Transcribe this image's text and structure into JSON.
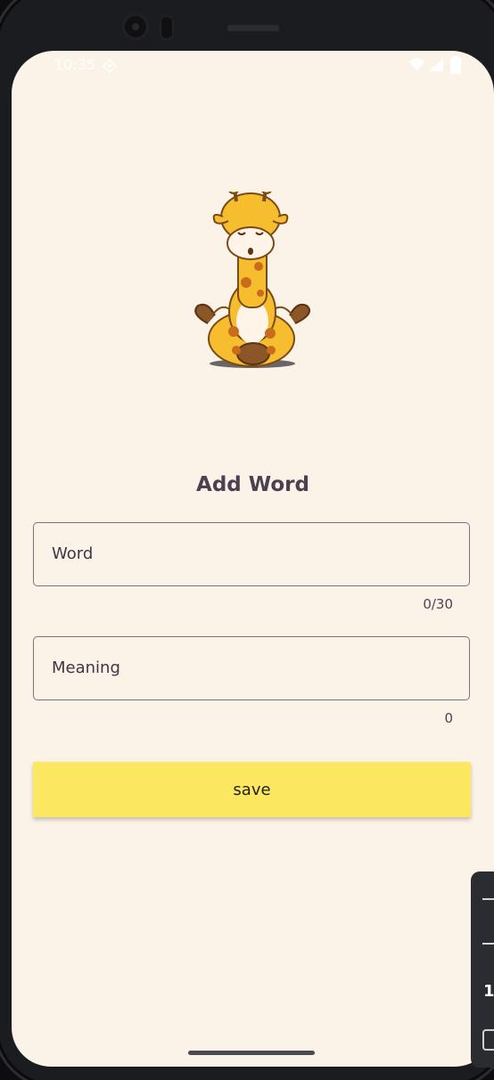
{
  "status_bar": {
    "time": "10:35",
    "icons": [
      "sim-card-icon",
      "wifi-icon",
      "signal-icon",
      "battery-icon"
    ]
  },
  "illustration": {
    "icon": "meditating-giraffe-illustration"
  },
  "page": {
    "title": "Add Word"
  },
  "form": {
    "word": {
      "label": "Word",
      "counter": "0/30"
    },
    "meaning": {
      "label": "Meaning",
      "counter": "0"
    },
    "save_label": "save"
  },
  "side_panel": {
    "number": "1"
  },
  "colors": {
    "background": "#fbf3e7",
    "button": "#fce760",
    "text": "#4a4250",
    "border": "#7a7280"
  }
}
